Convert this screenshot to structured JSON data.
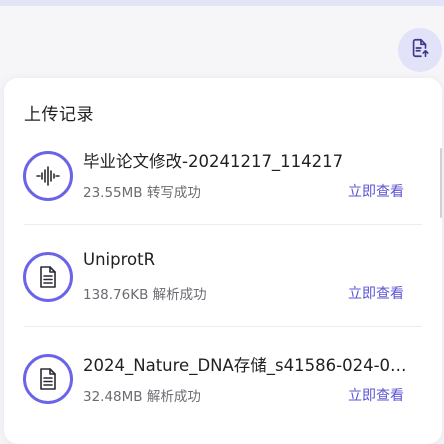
{
  "panel": {
    "title": "上传记录"
  },
  "records": [
    {
      "icon": "audio-waveform-icon",
      "name": "毕业论文修改-20241217_114217",
      "size": "23.55MB",
      "status": "转写成功",
      "action": "立即查看"
    },
    {
      "icon": "document-icon",
      "name": "UniprotR",
      "size": "138.76KB",
      "status": "解析成功",
      "action": "立即查看"
    },
    {
      "icon": "document-icon",
      "name": "2024_Nature_DNA存储_s41586-024-08...",
      "size": "32.48MB",
      "status": "解析成功",
      "action": "立即查看"
    }
  ],
  "colors": {
    "accent": "#6b63e8",
    "link": "#5a54d6",
    "fab_bg": "#e2e2f8"
  },
  "icons": {
    "fab": "upload-document-icon"
  }
}
